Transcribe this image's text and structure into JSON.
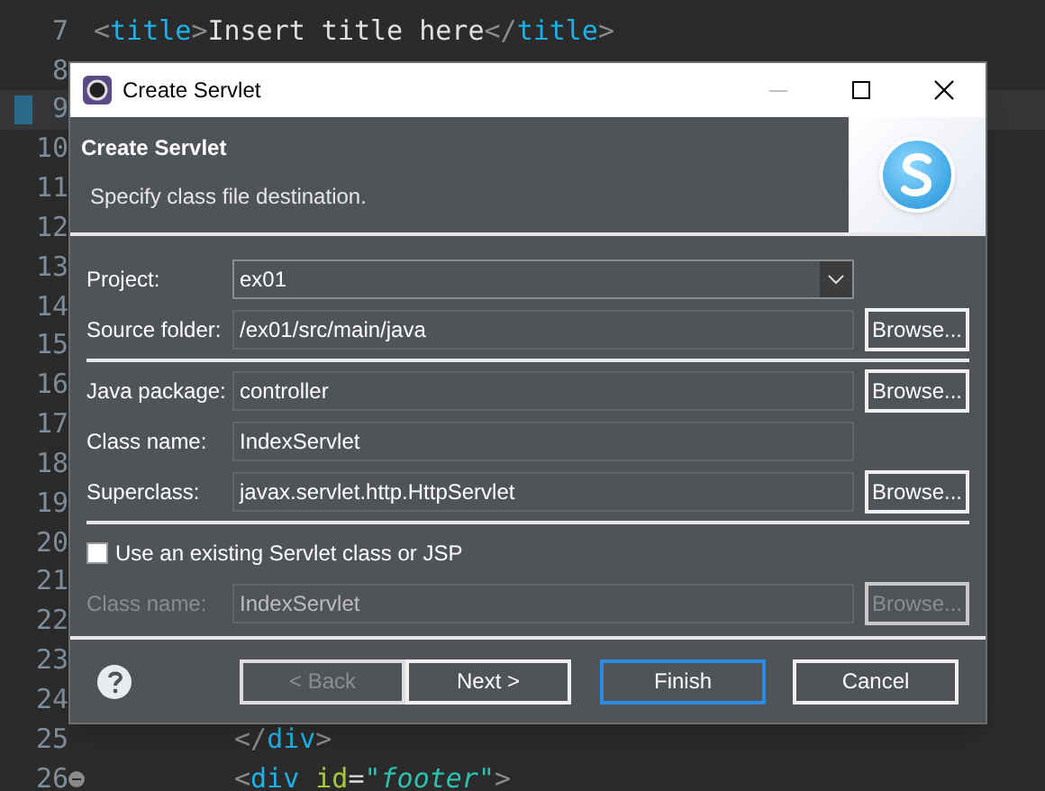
{
  "editor": {
    "lines": [
      {
        "number": "7",
        "current": false,
        "indented": false,
        "foldable": false,
        "code": [
          {
            "kind": "bracket",
            "text": "<"
          },
          {
            "kind": "tag",
            "text": "title"
          },
          {
            "kind": "bracket",
            "text": ">"
          },
          {
            "kind": "text",
            "text": "Insert title here"
          },
          {
            "kind": "bracket",
            "text": "</"
          },
          {
            "kind": "tag",
            "text": "title"
          },
          {
            "kind": "bracket",
            "text": ">"
          }
        ]
      },
      {
        "number": "8",
        "current": false
      },
      {
        "number": "9",
        "current": true
      },
      {
        "number": "10",
        "current": false
      },
      {
        "number": "11",
        "current": false
      },
      {
        "number": "12",
        "current": false
      },
      {
        "number": "13",
        "current": false
      },
      {
        "number": "14",
        "current": false
      },
      {
        "number": "15",
        "current": false
      },
      {
        "number": "16",
        "current": false
      },
      {
        "number": "17",
        "current": false
      },
      {
        "number": "18",
        "current": false
      },
      {
        "number": "19",
        "current": false
      },
      {
        "number": "20",
        "current": false
      },
      {
        "number": "21",
        "current": false
      },
      {
        "number": "22",
        "current": false
      },
      {
        "number": "23",
        "current": false
      },
      {
        "number": "24",
        "current": false
      },
      {
        "number": "25",
        "current": false,
        "indented": true,
        "foldable": false,
        "code": [
          {
            "kind": "bracket",
            "text": "</"
          },
          {
            "kind": "tag",
            "text": "div"
          },
          {
            "kind": "bracket",
            "text": ">"
          }
        ]
      },
      {
        "number": "26",
        "current": false,
        "indented": true,
        "foldable": true,
        "code": [
          {
            "kind": "bracket",
            "text": "<"
          },
          {
            "kind": "tag",
            "text": "div"
          },
          {
            "kind": "attr",
            "text": " id"
          },
          {
            "kind": "text",
            "text": "="
          },
          {
            "kind": "string",
            "text": "\"footer\""
          },
          {
            "kind": "bracket",
            "text": ">"
          }
        ]
      }
    ]
  },
  "dialog": {
    "title": "Create Servlet",
    "header_title": "Create Servlet",
    "header_description": "Specify class file destination.",
    "sections": [
      [
        {
          "kind": "combo",
          "label": "Project:",
          "value": "ex01"
        },
        {
          "kind": "field",
          "label": "Source folder:",
          "value": "/ex01/src/main/java",
          "button": "Browse...",
          "disabled": false
        }
      ],
      [
        {
          "kind": "field",
          "label": "Java package:",
          "value": "controller",
          "button": "Browse...",
          "disabled": false
        },
        {
          "kind": "field",
          "label": "Class name:",
          "value": "IndexServlet",
          "disabled": false
        },
        {
          "kind": "field",
          "label": "Superclass:",
          "value": "javax.servlet.http.HttpServlet",
          "button": "Browse...",
          "disabled": false
        }
      ],
      [
        {
          "kind": "checkbox",
          "label": "Use an existing Servlet class or JSP",
          "checked": false
        },
        {
          "kind": "field",
          "label": "Class name:",
          "value": "IndexServlet",
          "button": "Browse...",
          "disabled": true
        }
      ]
    ],
    "buttons": [
      {
        "label": "< Back",
        "disabled": true,
        "default": false
      },
      {
        "label": "Next >",
        "disabled": false,
        "default": false
      },
      {
        "label": "Finish",
        "disabled": false,
        "default": true
      },
      {
        "label": "Cancel",
        "disabled": false,
        "default": false
      }
    ]
  }
}
